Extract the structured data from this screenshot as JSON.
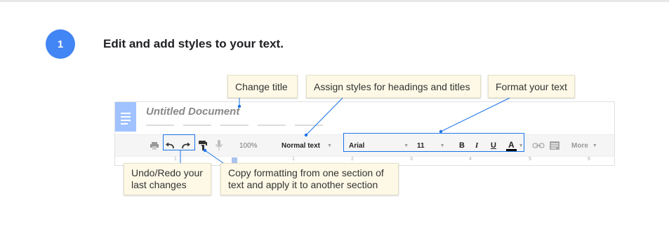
{
  "step": {
    "number": "1",
    "title": "Edit and add styles to your text."
  },
  "callouts": {
    "change_title": "Change title",
    "assign_styles": "Assign styles for headings and titles",
    "format_text": "Format your text",
    "undo_redo": "Undo/Redo your\nlast changes",
    "copy_formatting": "Copy formatting from one section of\ntext and apply it to another section"
  },
  "doc": {
    "title": "Untitled Document"
  },
  "toolbar": {
    "zoom": "100%",
    "style": "Normal text",
    "font": "Arial",
    "size": "11",
    "bold": "B",
    "italic": "I",
    "underline": "U",
    "text_color": "A",
    "more": "More"
  },
  "ruler": [
    "1",
    "1",
    "2",
    "3",
    "4",
    "5",
    "6"
  ],
  "colors": {
    "accent": "#4285f4",
    "callout_bg": "#fdf9e6",
    "connector": "#1a73e8"
  }
}
